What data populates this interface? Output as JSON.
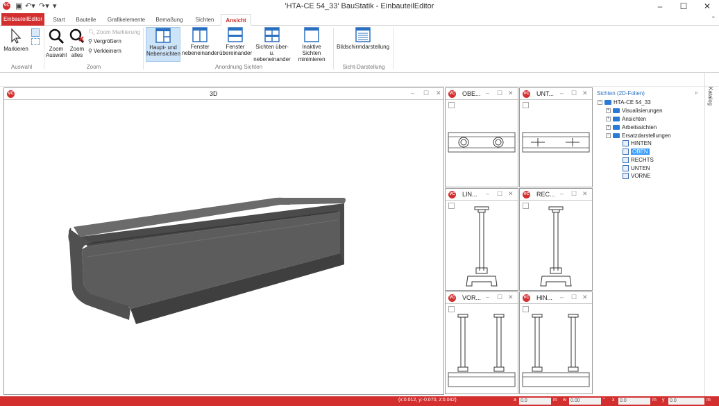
{
  "window": {
    "title": "'HTA-CE 54_33' BauStatik       - EinbauteilEditor",
    "controls": [
      "–",
      "☐",
      "✕"
    ]
  },
  "tabs": [
    "EinbauteilEditor",
    "Start",
    "Bauteile",
    "Grafikelemente",
    "Bemaßung",
    "Sichten",
    "Ansicht"
  ],
  "ribbon": {
    "markieren": "Markieren",
    "zoom_auswahl": [
      "Zoom",
      "Auswahl"
    ],
    "zoom_alles": [
      "Zoom",
      "alles"
    ],
    "zoom_markierung": "Zoom Markierung",
    "vergroessern": "Vergrößern",
    "verkleinern": "Verkleinern",
    "haupt": [
      "Haupt- und",
      "Nebensichten"
    ],
    "fenster_neben": [
      "Fenster",
      "nebeneinander"
    ],
    "fenster_ueber": [
      "Fenster",
      "übereinander"
    ],
    "sichten_ueber": [
      "Sichten über- u.",
      "nebeneinander"
    ],
    "inaktive": [
      "Inaktive Sichten",
      "minimieren"
    ],
    "bildschirm": "Bildschirmdarstellung",
    "groups": [
      "Auswahl",
      "Zoom",
      "Anordnung Sichten",
      "Sicht-Darstellung"
    ]
  },
  "panes": {
    "main": "3D",
    "oben": "OBE...",
    "unten": "UNT...",
    "links": "LIN...",
    "rechts": "REC...",
    "vorne": "VOR...",
    "hinten": "HIN..."
  },
  "tree": {
    "header": "Sichten (2D-Folien)",
    "root": "HTA-CE 54_33",
    "folders": [
      "Visualisierungen",
      "Ansichten",
      "Arbeitssichten",
      "Ersatzdarstellungen"
    ],
    "sheets": [
      "HINTEN",
      "OBEN",
      "RECHTS",
      "UNTEN",
      "VORNE"
    ],
    "selected": "OBEN",
    "pin": "ᵖ"
  },
  "sidebar_label": "Katalog",
  "status": {
    "coords": "(x:0.012, y:-0.070, z:0.042)",
    "fields": [
      {
        "label": "a",
        "value": "0.0",
        "unit": "m"
      },
      {
        "label": "w",
        "value": "0.00",
        "unit": "°"
      },
      {
        "label": "x",
        "value": "0.0",
        "unit": "m"
      },
      {
        "label": "y",
        "value": "0.0",
        "unit": "m"
      }
    ]
  }
}
